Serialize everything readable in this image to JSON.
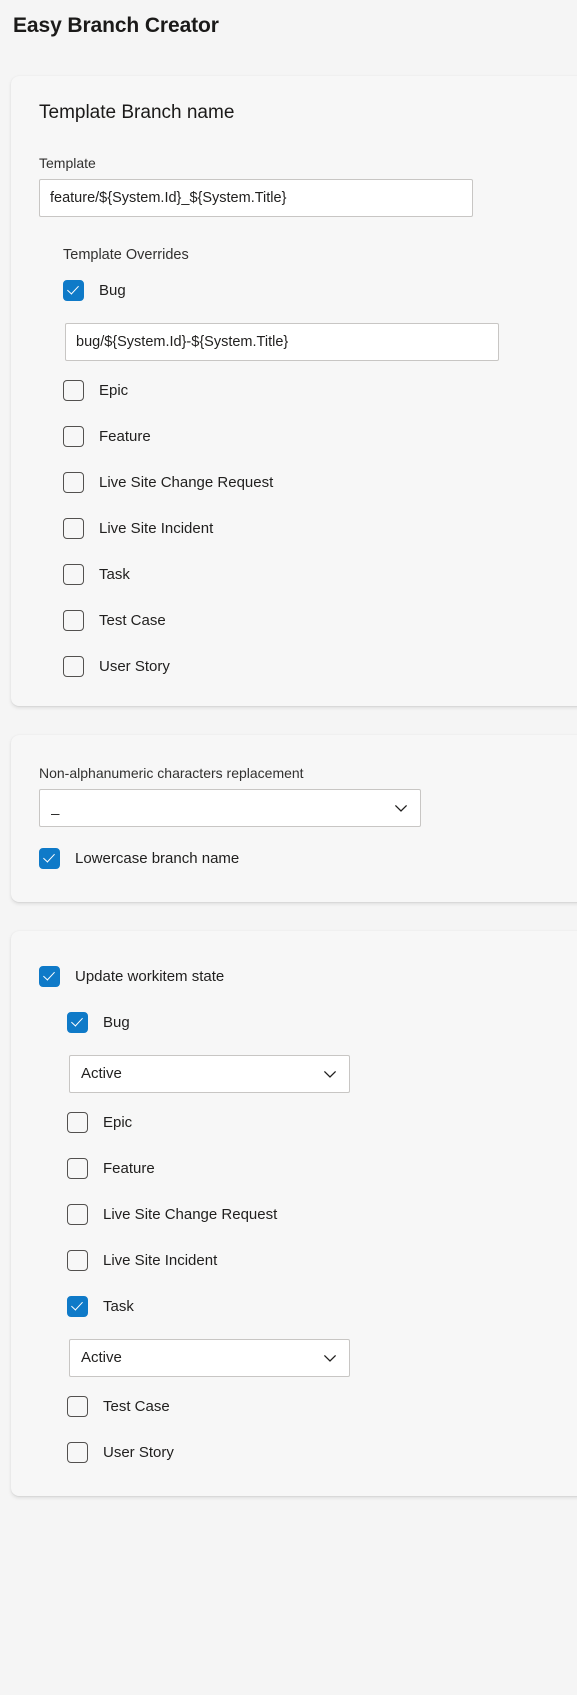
{
  "app": {
    "title": "Easy Branch Creator"
  },
  "template_card": {
    "heading": "Template Branch name",
    "template_field_label": "Template",
    "template_value": "feature/${System.Id}_${System.Title}",
    "overrides_label": "Template Overrides",
    "overrides": [
      {
        "label": "Bug",
        "checked": true,
        "value": "bug/${System.Id}-${System.Title}"
      },
      {
        "label": "Epic",
        "checked": false
      },
      {
        "label": "Feature",
        "checked": false
      },
      {
        "label": "Live Site Change Request",
        "checked": false
      },
      {
        "label": "Live Site Incident",
        "checked": false
      },
      {
        "label": "Task",
        "checked": false
      },
      {
        "label": "Test Case",
        "checked": false
      },
      {
        "label": "User Story",
        "checked": false
      }
    ]
  },
  "replacement_card": {
    "label": "Non-alphanumeric characters replacement",
    "selected": "_",
    "lowercase_label": "Lowercase branch name",
    "lowercase_checked": true
  },
  "state_card": {
    "update_label": "Update workitem state",
    "update_checked": true,
    "items": [
      {
        "label": "Bug",
        "checked": true,
        "state": "Active"
      },
      {
        "label": "Epic",
        "checked": false
      },
      {
        "label": "Feature",
        "checked": false
      },
      {
        "label": "Live Site Change Request",
        "checked": false
      },
      {
        "label": "Live Site Incident",
        "checked": false
      },
      {
        "label": "Task",
        "checked": true,
        "state": "Active"
      },
      {
        "label": "Test Case",
        "checked": false
      },
      {
        "label": "User Story",
        "checked": false
      }
    ]
  },
  "colors": {
    "accent": "#0f7ac8",
    "page_bg": "#f5f5f5",
    "card_bg": "#f7f7f7",
    "input_border": "#c8c6c4",
    "text": "#201f1e"
  },
  "icons": {
    "chevron_down": "chevron-down-icon",
    "check": "check-icon"
  }
}
